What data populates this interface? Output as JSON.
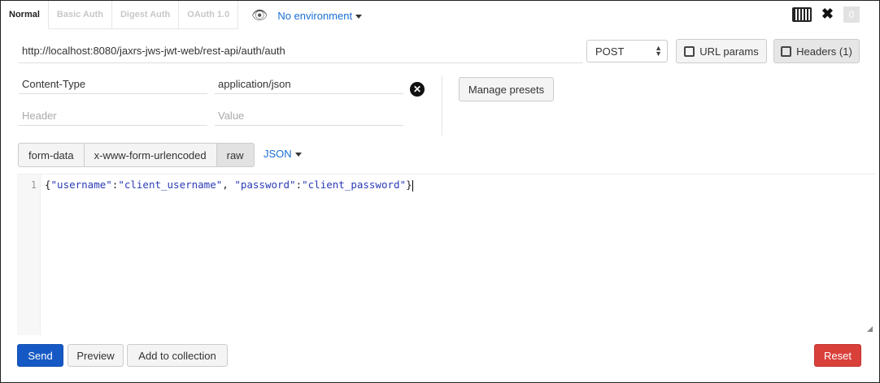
{
  "auth_tabs": [
    "Normal",
    "Basic Auth",
    "Digest Auth",
    "OAuth 1.0"
  ],
  "environment": {
    "label": "No environment"
  },
  "toolbar": {
    "count": "0"
  },
  "request": {
    "url": "http://localhost:8080/jaxrs-jws-jwt-web/rest-api/auth/auth",
    "method": "POST",
    "url_params_label": "URL params",
    "headers_label": "Headers (1)"
  },
  "headers": [
    {
      "key": "Content-Type",
      "value": "application/json"
    }
  ],
  "new_header": {
    "key_placeholder": "Header",
    "value_placeholder": "Value"
  },
  "manage_presets_label": "Manage presets",
  "body_types": [
    "form-data",
    "x-www-form-urlencoded",
    "raw"
  ],
  "body_format": "JSON",
  "editor": {
    "line_number": "1",
    "p1": "{",
    "s1": "\"username\"",
    "p2": ":",
    "s2": "\"client_username\"",
    "p3": ", ",
    "s3": "\"password\"",
    "p4": ":",
    "s4": "\"client_password\"",
    "p5": "}"
  },
  "actions": {
    "send": "Send",
    "preview": "Preview",
    "add_to_collection": "Add to collection",
    "reset": "Reset"
  },
  "colors": {
    "primary": "#1659c5",
    "danger": "#d9403a",
    "link": "#1a6fd6"
  }
}
